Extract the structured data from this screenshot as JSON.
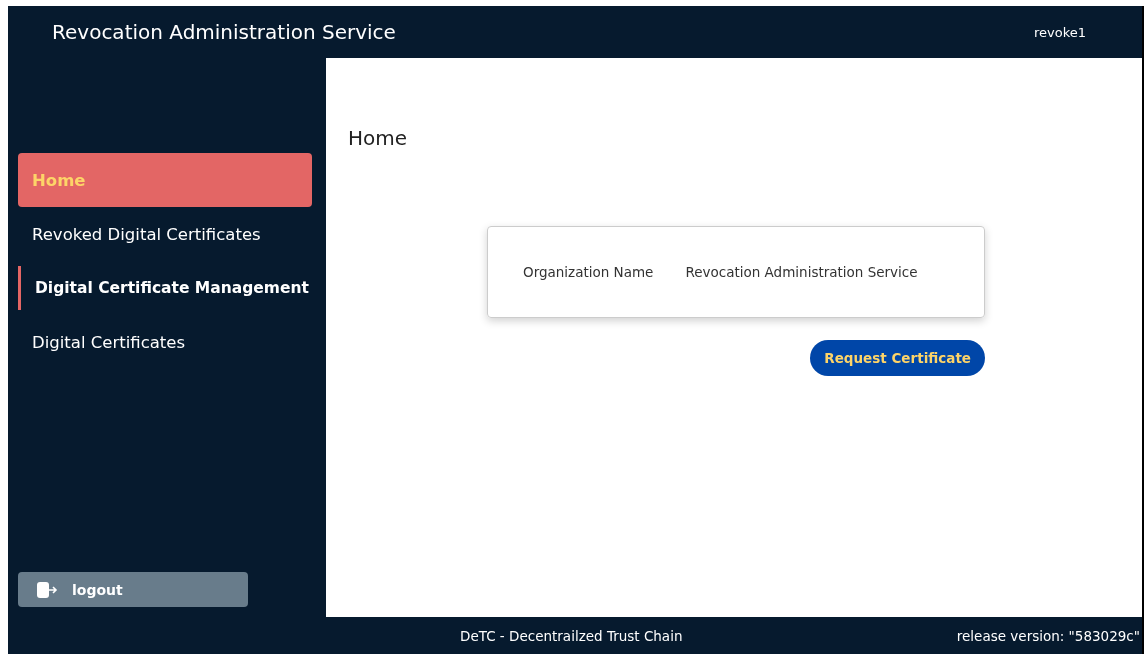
{
  "header": {
    "title": "Revocation Administration Service",
    "user": "revoke1"
  },
  "sidebar": {
    "items": [
      {
        "label": "Home",
        "kind": "link",
        "selected": true
      },
      {
        "label": "Revoked Digital Certificates",
        "kind": "link",
        "selected": false
      },
      {
        "label": "Digital Certificate Management",
        "kind": "group",
        "selected": false
      },
      {
        "label": "Digital Certificates",
        "kind": "link",
        "selected": false
      }
    ],
    "logout": "logout"
  },
  "page": {
    "title": "Home",
    "info": [
      {
        "label": "Organization Name",
        "value": "Revocation Administration Service"
      }
    ],
    "button": "Request Certificate"
  },
  "footer": {
    "center": "DeTC - Decentrailzed Trust Chain",
    "version": "release version: \"583029c\""
  }
}
